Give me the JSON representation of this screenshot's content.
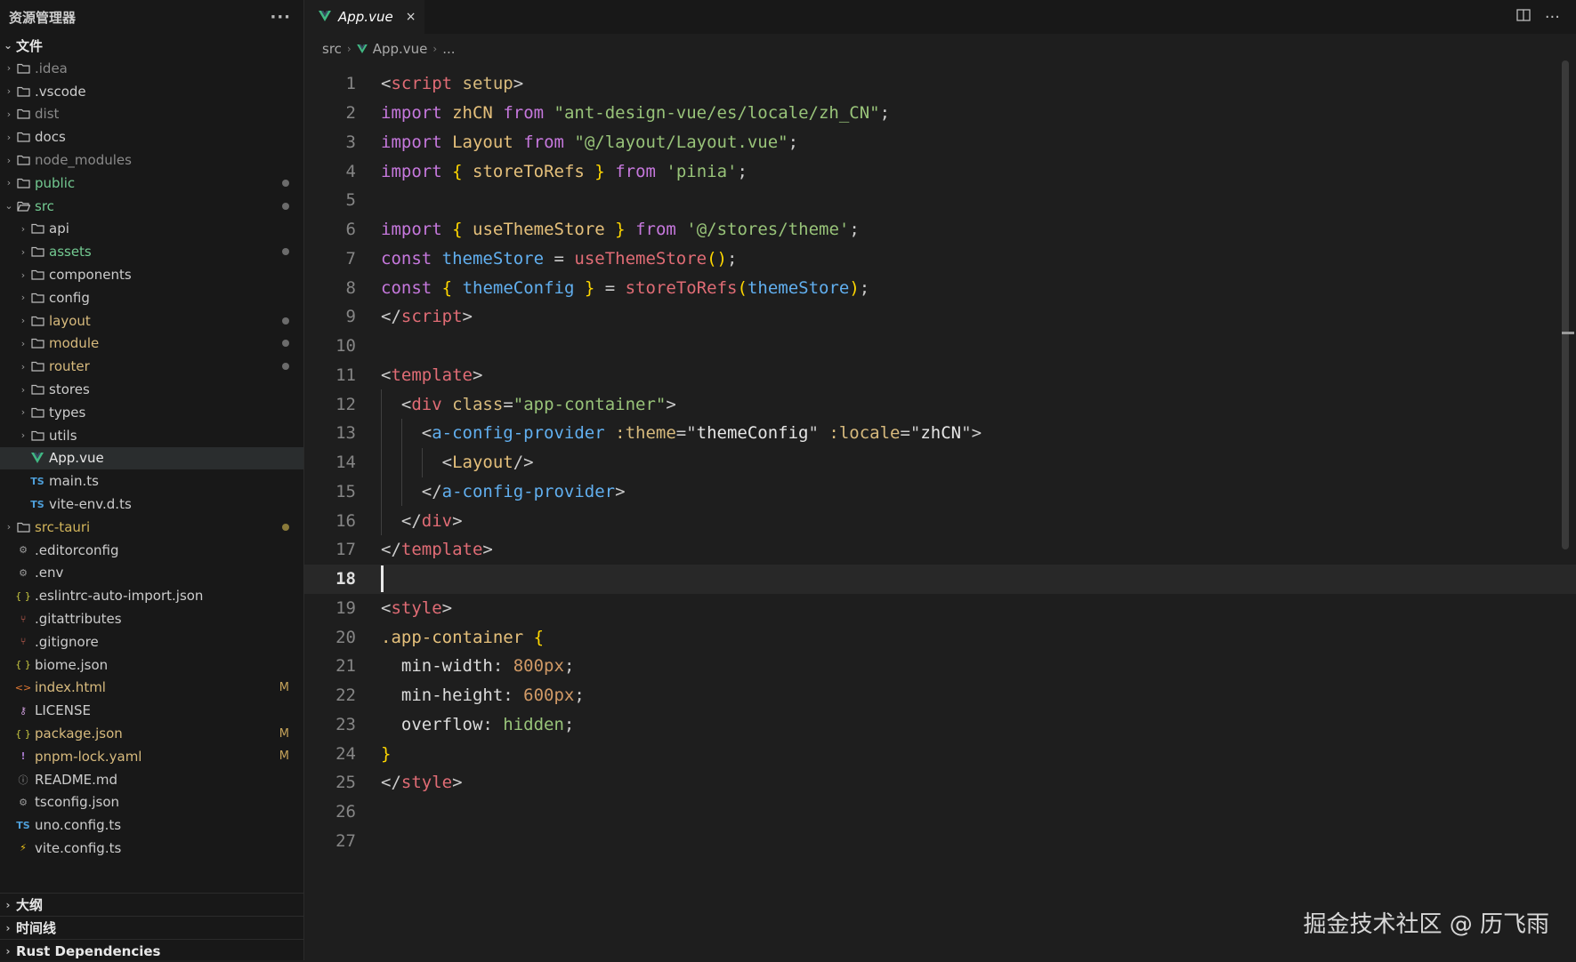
{
  "sidebar": {
    "title": "资源管理器",
    "more": "···",
    "files_section": "文件",
    "tree": [
      {
        "label": ".idea",
        "type": "folder",
        "level": 0,
        "collapsed": true,
        "color": "dim"
      },
      {
        "label": ".vscode",
        "type": "folder",
        "level": 0,
        "collapsed": true,
        "color": "norm"
      },
      {
        "label": "dist",
        "type": "folder",
        "level": 0,
        "collapsed": true,
        "color": "dim"
      },
      {
        "label": "docs",
        "type": "folder",
        "level": 0,
        "collapsed": true,
        "color": "norm"
      },
      {
        "label": "node_modules",
        "type": "folder",
        "level": 0,
        "collapsed": true,
        "color": "dim"
      },
      {
        "label": "public",
        "type": "folder",
        "level": 0,
        "collapsed": true,
        "color": "green",
        "marker": "dot"
      },
      {
        "label": "src",
        "type": "folder-open",
        "level": 0,
        "collapsed": false,
        "color": "green",
        "marker": "dot"
      },
      {
        "label": "api",
        "type": "folder",
        "level": 1,
        "collapsed": true,
        "color": "norm"
      },
      {
        "label": "assets",
        "type": "folder",
        "level": 1,
        "collapsed": true,
        "color": "green",
        "marker": "dot"
      },
      {
        "label": "components",
        "type": "folder",
        "level": 1,
        "collapsed": true,
        "color": "norm"
      },
      {
        "label": "config",
        "type": "folder",
        "level": 1,
        "collapsed": true,
        "color": "norm"
      },
      {
        "label": "layout",
        "type": "folder",
        "level": 1,
        "collapsed": true,
        "color": "amber",
        "marker": "dot"
      },
      {
        "label": "module",
        "type": "folder",
        "level": 1,
        "collapsed": true,
        "color": "amber",
        "marker": "dot"
      },
      {
        "label": "router",
        "type": "folder",
        "level": 1,
        "collapsed": true,
        "color": "amber",
        "marker": "dot"
      },
      {
        "label": "stores",
        "type": "folder",
        "level": 1,
        "collapsed": true,
        "color": "norm"
      },
      {
        "label": "types",
        "type": "folder",
        "level": 1,
        "collapsed": true,
        "color": "norm"
      },
      {
        "label": "utils",
        "type": "folder",
        "level": 1,
        "collapsed": true,
        "color": "norm"
      },
      {
        "label": "App.vue",
        "type": "vue",
        "level": 1,
        "color": "white",
        "selected": true
      },
      {
        "label": "main.ts",
        "type": "ts",
        "level": 1,
        "color": "norm"
      },
      {
        "label": "vite-env.d.ts",
        "type": "ts",
        "level": 1,
        "color": "norm"
      },
      {
        "label": "src-tauri",
        "type": "folder",
        "level": 0,
        "collapsed": true,
        "color": "yellowish",
        "marker": "dot-amber"
      },
      {
        "label": ".editorconfig",
        "type": "gear",
        "level": 0,
        "color": "norm"
      },
      {
        "label": ".env",
        "type": "gear",
        "level": 0,
        "color": "norm"
      },
      {
        "label": ".eslintrc-auto-import.json",
        "type": "json",
        "level": 0,
        "color": "norm"
      },
      {
        "label": ".gitattributes",
        "type": "git",
        "level": 0,
        "color": "norm"
      },
      {
        "label": ".gitignore",
        "type": "git",
        "level": 0,
        "color": "norm"
      },
      {
        "label": "biome.json",
        "type": "json",
        "level": 0,
        "color": "norm"
      },
      {
        "label": "index.html",
        "type": "html",
        "level": 0,
        "color": "amber",
        "badge": "M"
      },
      {
        "label": "LICENSE",
        "type": "key",
        "level": 0,
        "color": "norm"
      },
      {
        "label": "package.json",
        "type": "json",
        "level": 0,
        "color": "amber",
        "badge": "M"
      },
      {
        "label": "pnpm-lock.yaml",
        "type": "yaml",
        "level": 0,
        "color": "amber",
        "badge": "M"
      },
      {
        "label": "README.md",
        "type": "info",
        "level": 0,
        "color": "norm"
      },
      {
        "label": "tsconfig.json",
        "type": "gear",
        "level": 0,
        "color": "norm"
      },
      {
        "label": "uno.config.ts",
        "type": "ts",
        "level": 0,
        "color": "norm"
      },
      {
        "label": "vite.config.ts",
        "type": "bolt",
        "level": 0,
        "color": "norm"
      }
    ],
    "bottom_sections": [
      "大纲",
      "时间线",
      "Rust Dependencies"
    ]
  },
  "editor": {
    "tab": {
      "label": "App.vue",
      "close": "×"
    },
    "breadcrumb": [
      "src",
      "App.vue",
      "..."
    ],
    "current_line": 18,
    "lines": [
      [
        [
          "t-punc",
          "<"
        ],
        [
          "t-tag",
          "script"
        ],
        [
          "t-punc",
          " "
        ],
        [
          "t-attr",
          "setup"
        ],
        [
          "t-punc",
          ">"
        ]
      ],
      [
        [
          "t-kw",
          "import"
        ],
        [
          "t-punc",
          " "
        ],
        [
          "t-ident",
          "zhCN"
        ],
        [
          "t-punc",
          " "
        ],
        [
          "t-kw",
          "from"
        ],
        [
          "t-punc",
          " "
        ],
        [
          "t-str",
          "\"ant-design-vue/es/locale/zh_CN\""
        ],
        [
          "t-punc",
          ";"
        ]
      ],
      [
        [
          "t-kw",
          "import"
        ],
        [
          "t-punc",
          " "
        ],
        [
          "t-ident",
          "Layout"
        ],
        [
          "t-punc",
          " "
        ],
        [
          "t-kw",
          "from"
        ],
        [
          "t-punc",
          " "
        ],
        [
          "t-str",
          "\"@/layout/Layout.vue\""
        ],
        [
          "t-punc",
          ";"
        ]
      ],
      [
        [
          "t-kw",
          "import"
        ],
        [
          "t-punc",
          " "
        ],
        [
          "t-brace",
          "{"
        ],
        [
          "t-punc",
          " "
        ],
        [
          "t-ident",
          "storeToRefs"
        ],
        [
          "t-punc",
          " "
        ],
        [
          "t-brace",
          "}"
        ],
        [
          "t-punc",
          " "
        ],
        [
          "t-kw",
          "from"
        ],
        [
          "t-punc",
          " "
        ],
        [
          "t-str",
          "'pinia'"
        ],
        [
          "t-punc",
          ";"
        ]
      ],
      [],
      [
        [
          "t-kw",
          "import"
        ],
        [
          "t-punc",
          " "
        ],
        [
          "t-brace",
          "{"
        ],
        [
          "t-punc",
          " "
        ],
        [
          "t-ident",
          "useThemeStore"
        ],
        [
          "t-punc",
          " "
        ],
        [
          "t-brace",
          "}"
        ],
        [
          "t-punc",
          " "
        ],
        [
          "t-kw",
          "from"
        ],
        [
          "t-punc",
          " "
        ],
        [
          "t-str",
          "'@/stores/theme'"
        ],
        [
          "t-punc",
          ";"
        ]
      ],
      [
        [
          "t-kw",
          "const"
        ],
        [
          "t-punc",
          " "
        ],
        [
          "t-var",
          "themeStore"
        ],
        [
          "t-punc",
          " = "
        ],
        [
          "t-fn",
          "useThemeStore"
        ],
        [
          "t-brace",
          "()"
        ],
        [
          "t-punc",
          ";"
        ]
      ],
      [
        [
          "t-kw",
          "const"
        ],
        [
          "t-punc",
          " "
        ],
        [
          "t-brace",
          "{"
        ],
        [
          "t-punc",
          " "
        ],
        [
          "t-var",
          "themeConfig"
        ],
        [
          "t-punc",
          " "
        ],
        [
          "t-brace",
          "}"
        ],
        [
          "t-punc",
          " = "
        ],
        [
          "t-fn",
          "storeToRefs"
        ],
        [
          "t-brace",
          "("
        ],
        [
          "t-var",
          "themeStore"
        ],
        [
          "t-brace",
          ")"
        ],
        [
          "t-punc",
          ";"
        ]
      ],
      [
        [
          "t-punc",
          "</"
        ],
        [
          "t-tag",
          "script"
        ],
        [
          "t-punc",
          ">"
        ]
      ],
      [],
      [
        [
          "t-punc",
          "<"
        ],
        [
          "t-tag",
          "template"
        ],
        [
          "t-punc",
          ">"
        ]
      ],
      [
        [
          "t-punc",
          "  <"
        ],
        [
          "t-tag",
          "div"
        ],
        [
          "t-punc",
          " "
        ],
        [
          "t-attr",
          "class"
        ],
        [
          "t-punc",
          "="
        ],
        [
          "t-str",
          "\"app-container\""
        ],
        [
          "t-punc",
          ">"
        ]
      ],
      [
        [
          "t-punc",
          "    <"
        ],
        [
          "t-comp",
          "a-config-provider"
        ],
        [
          "t-punc",
          " "
        ],
        [
          "t-attr",
          ":theme"
        ],
        [
          "t-punc",
          "=\""
        ],
        [
          "t-white",
          "themeConfig"
        ],
        [
          "t-punc",
          "\" "
        ],
        [
          "t-attr",
          ":locale"
        ],
        [
          "t-punc",
          "=\""
        ],
        [
          "t-white",
          "zhCN"
        ],
        [
          "t-punc",
          "\">"
        ]
      ],
      [
        [
          "t-punc",
          "      <"
        ],
        [
          "t-ident",
          "Layout"
        ],
        [
          "t-punc",
          "/>"
        ]
      ],
      [
        [
          "t-punc",
          "    </"
        ],
        [
          "t-comp",
          "a-config-provider"
        ],
        [
          "t-punc",
          ">"
        ]
      ],
      [
        [
          "t-punc",
          "  </"
        ],
        [
          "t-tag",
          "div"
        ],
        [
          "t-punc",
          ">"
        ]
      ],
      [
        [
          "t-punc",
          "</"
        ],
        [
          "t-tag",
          "template"
        ],
        [
          "t-punc",
          ">"
        ]
      ],
      [],
      [
        [
          "t-punc",
          "<"
        ],
        [
          "t-tag",
          "style"
        ],
        [
          "t-punc",
          ">"
        ]
      ],
      [
        [
          "t-cls",
          ".app-container"
        ],
        [
          "t-punc",
          " "
        ],
        [
          "t-brace",
          "{"
        ]
      ],
      [
        [
          "t-prop",
          "  min-width"
        ],
        [
          "t-punc",
          ": "
        ],
        [
          "t-num",
          "800px"
        ],
        [
          "t-punc",
          ";"
        ]
      ],
      [
        [
          "t-prop",
          "  min-height"
        ],
        [
          "t-punc",
          ": "
        ],
        [
          "t-num",
          "600px"
        ],
        [
          "t-punc",
          ";"
        ]
      ],
      [
        [
          "t-prop",
          "  overflow"
        ],
        [
          "t-punc",
          ": "
        ],
        [
          "t-str",
          "hidden"
        ],
        [
          "t-punc",
          ";"
        ]
      ],
      [
        [
          "t-brace",
          "}"
        ]
      ],
      [
        [
          "t-punc",
          "</"
        ],
        [
          "t-tag",
          "style"
        ],
        [
          "t-punc",
          ">"
        ]
      ],
      [],
      []
    ]
  },
  "watermark": "掘金技术社区 @ 历飞雨"
}
